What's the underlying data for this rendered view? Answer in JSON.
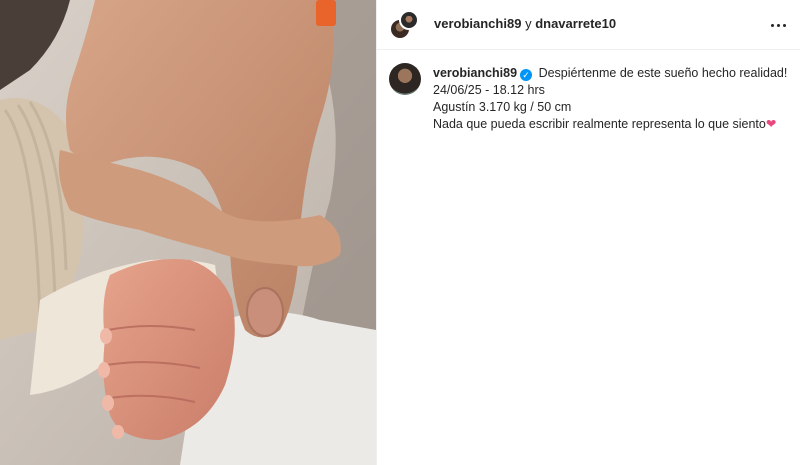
{
  "header": {
    "user1": "verobianchi89",
    "joiner": "y",
    "user2": "dnavarrete10",
    "more_icon": "more-horizontal-icon"
  },
  "caption": {
    "username": "verobianchi89",
    "verified_icon": "verified-badge-icon",
    "verified_glyph": "✓",
    "line1": "Despiértenme de este sueño hecho realidad!",
    "line2": "24/06/25 - 18.12 hrs",
    "line3": "Agustín 3.170 kg / 50 cm",
    "line4": "Nada que pueda escribir realmente representa lo que siento",
    "heart": "❤"
  },
  "colors": {
    "accent": "#0095f6",
    "text": "#262626",
    "heart": "#e8487c"
  }
}
